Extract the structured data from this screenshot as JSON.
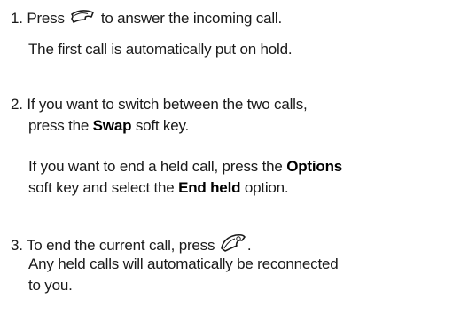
{
  "step1": {
    "number": "1.",
    "before_icon": "Press",
    "icon": "send-call-icon",
    "after_icon": "to answer the incoming call.",
    "line2": "The first call is automatically put on hold."
  },
  "step2": {
    "number": "2.",
    "line1": "If you want to switch between the two calls,",
    "line2_pre": "press the",
    "line2_bold": "Swap",
    "line2_post": "soft key.",
    "para2_line1_pre": "If you want to end a held call, press the",
    "para2_line1_bold": "Options",
    "para2_line2_pre": "soft key and select the",
    "para2_line2_bold": "End held",
    "para2_line2_post": "option."
  },
  "step3": {
    "number": "3.",
    "before_icon": "To end the current call, press",
    "icon": "end-call-icon",
    "after_icon": ".",
    "line2": "Any held calls will automatically  be reconnected",
    "line3": "to you."
  }
}
